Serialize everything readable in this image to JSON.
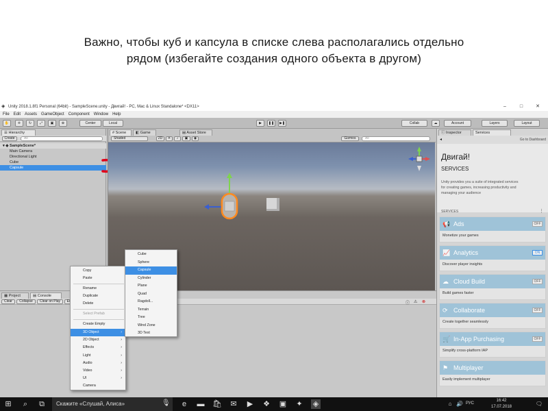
{
  "caption": {
    "line1": "Важно, чтобы куб и капсула в списке слева располагались отдельно",
    "line2": "рядом (избегайте создания одного объекта в другом)"
  },
  "window": {
    "title": "Unity 2018.1.8f1 Personal (64bit) - SampleScene.unity - Двигай! - PC, Mac & Linux Standalone* <DX11>"
  },
  "menu": [
    "File",
    "Edit",
    "Assets",
    "GameObject",
    "Component",
    "Window",
    "Help"
  ],
  "toolbar": {
    "center": "Center",
    "local": "Local",
    "collab": "Collab",
    "account": "Account",
    "layers": "Layers",
    "layout": "Layout"
  },
  "hierarchy": {
    "tab": "Hierarchy",
    "create": "Create",
    "search_placeholder": "All",
    "scene": "SampleScene*",
    "items": [
      "Main Camera",
      "Directional Light",
      "Cube",
      "Capsule"
    ]
  },
  "scene_tabs": {
    "scene": "Scene",
    "game": "Game",
    "asset_store": "Asset Store",
    "shaded": "Shaded",
    "two_d": "2D",
    "gizmos": "Gizmos",
    "search_placeholder": "All"
  },
  "bottom_tabs": {
    "project": "Project",
    "console": "Console",
    "clear": "Clear",
    "collapse": "Collapse",
    "clear_on_play": "Clear on Play",
    "error_pause": "Error Pause"
  },
  "inspector": {
    "tab_inspector": "Inspector",
    "tab_services": "Services",
    "go_dashboard": "Go to Dashboard",
    "project_title": "Двигай!",
    "services_label": "SERVICES",
    "description": "Unity provides you a suite of integrated services for creating games, increasing productivity and managing your audience",
    "section": "SERVICES",
    "services": [
      {
        "name": "Ads",
        "desc": "Monetize your games",
        "state": "OFF",
        "color": "#9fc3d8"
      },
      {
        "name": "Analytics",
        "desc": "Discover player insights",
        "state": "ON",
        "color": "#9fc3d8"
      },
      {
        "name": "Cloud Build",
        "desc": "Build games faster",
        "state": "OFF",
        "color": "#9fc3d8"
      },
      {
        "name": "Collaborate",
        "desc": "Create together seamlessly",
        "state": "OFF",
        "color": "#9fc3d8"
      },
      {
        "name": "In-App Purchasing",
        "desc": "Simplify cross-platform IAP",
        "state": "OFF",
        "color": "#9fc3d8"
      },
      {
        "name": "Multiplayer",
        "desc": "Easily implement multiplayer",
        "state": "",
        "color": "#9fc3d8"
      }
    ]
  },
  "context_menu": {
    "items": [
      "Copy",
      "Paste",
      "Rename",
      "Duplicate",
      "Delete",
      "Select Prefab",
      "Create Empty",
      "3D Object",
      "2D Object",
      "Effects",
      "Light",
      "Audio",
      "Video",
      "UI",
      "Camera"
    ]
  },
  "submenu": {
    "items": [
      "Cube",
      "Sphere",
      "Capsule",
      "Cylinder",
      "Plane",
      "Quad",
      "Ragdoll...",
      "Terrain",
      "Tree",
      "Wind Zone",
      "3D Text"
    ]
  },
  "taskbar": {
    "search_text": "Скажите «Слушай, Алиса»",
    "time": "16:42",
    "date": "17.07.2018",
    "lang": "РУС"
  },
  "colors": {
    "selection": "#3d8fe4",
    "annotation": "#e0001a"
  }
}
